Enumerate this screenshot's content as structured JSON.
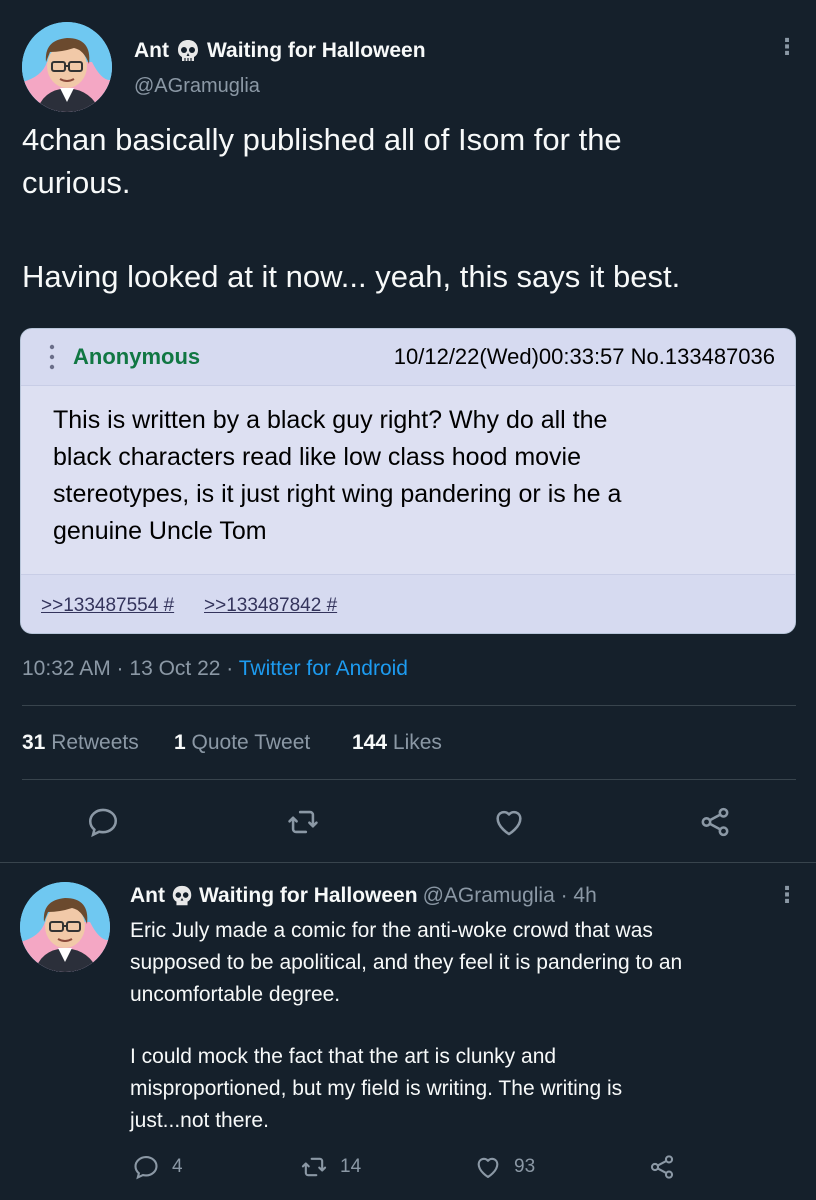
{
  "main_tweet": {
    "display_name": "Ant",
    "name_suffix": "Waiting for Halloween",
    "handle": "@AGramuglia",
    "text_line1": "4chan basically published all of Isom for the",
    "text_line2": "curious.",
    "text_line3": "Having looked at it now... yeah, this says it best.",
    "timestamp": "10:32 AM · 13 Oct 22 · ",
    "source": "Twitter for Android",
    "retweets_count": "31",
    "retweets_label": "Retweets",
    "quotes_count": "1",
    "quotes_label": "Quote Tweet",
    "likes_count": "144",
    "likes_label": "Likes"
  },
  "embedded_post": {
    "poster": "Anonymous",
    "datetime": "10/12/22(Wed)00:33:57 No.133487036",
    "comment_lines": [
      "This is written by a black guy right? Why do all the",
      "black characters read like low class hood movie",
      "stereotypes, is it just right wing pandering or is he a",
      "genuine Uncle Tom"
    ],
    "backlinks": [
      ">>133487554 #",
      ">>133487842 #"
    ]
  },
  "reply_tweet": {
    "display_name": "Ant",
    "name_suffix": "Waiting for Halloween",
    "handle_time": "@AGramuglia · 4h",
    "lines": [
      "Eric July made a comic for the anti-woke crowd that was",
      "supposed to be apolitical, and they feel it is pandering to an",
      "uncomfortable degree.",
      "I could mock the fact that the art is clunky and",
      "misproportioned, but my field is writing. The writing is",
      "just...not there."
    ],
    "reply_count": "4",
    "retweet_count": "14",
    "like_count": "93"
  },
  "colors": {
    "background": "#15202b",
    "text": "#f7f9f9",
    "secondary": "#8b98a5",
    "accent": "#1d9bf0",
    "card_bg": "#d6daf0",
    "anon_green": "#117743"
  },
  "icons": [
    "skull-icon",
    "more-icon",
    "reply-icon",
    "retweet-icon",
    "like-icon",
    "share-icon"
  ]
}
